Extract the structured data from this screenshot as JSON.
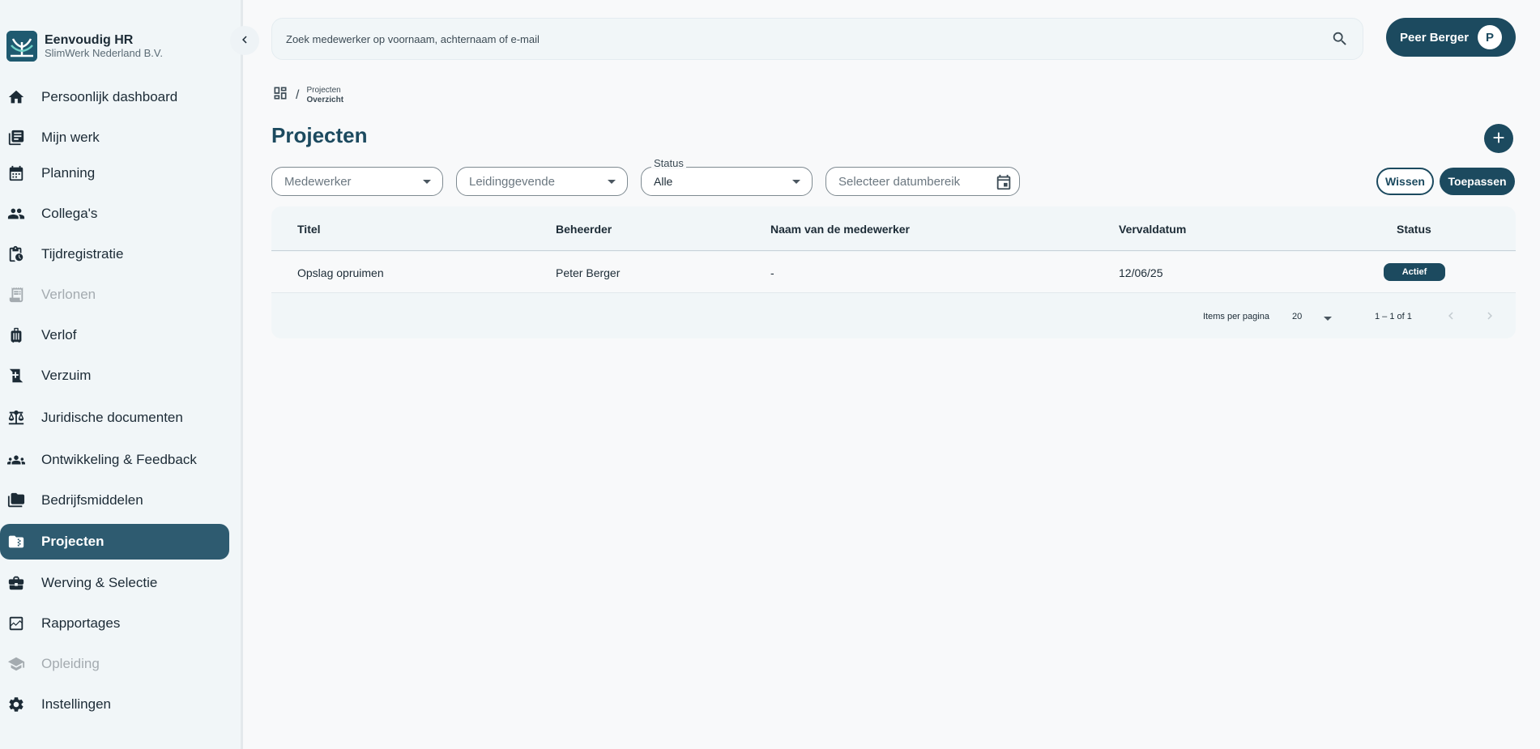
{
  "brand": {
    "name": "Eenvoudig HR",
    "org": "SlimWerk Nederland B.V.",
    "colors": {
      "primary": "#1c4a5f",
      "active_nav": "#2e5b70",
      "sidebar_bg": "#f1f6f8"
    }
  },
  "sidebar": {
    "collapse_icon": "chevron-left-icon",
    "items": [
      {
        "label": "Persoonlijk dashboard",
        "icon": "home-icon",
        "state": "normal"
      },
      {
        "label": "Mijn werk",
        "icon": "book-icon",
        "state": "normal"
      },
      {
        "label": "Planning",
        "icon": "calendar-icon",
        "state": "normal"
      },
      {
        "label": "Collega's",
        "icon": "people-icon",
        "state": "normal"
      },
      {
        "label": "Tijdregistratie",
        "icon": "clipboard-clock-icon",
        "state": "normal"
      },
      {
        "label": "Verlonen",
        "icon": "receipt-icon",
        "state": "disabled"
      },
      {
        "label": "Verlof",
        "icon": "luggage-icon",
        "state": "normal"
      },
      {
        "label": "Verzuim",
        "icon": "medical-icon",
        "state": "normal"
      },
      {
        "label": "Juridische documenten",
        "icon": "scale-icon",
        "state": "normal"
      },
      {
        "label": "Ontwikkeling & Feedback",
        "icon": "group-icon",
        "state": "normal"
      },
      {
        "label": "Bedrijfsmiddelen",
        "icon": "folders-icon",
        "state": "normal"
      },
      {
        "label": "Projecten",
        "icon": "folder-zip-icon",
        "state": "active"
      },
      {
        "label": "Werving & Selectie",
        "icon": "briefcase-icon",
        "state": "normal"
      },
      {
        "label": "Rapportages",
        "icon": "chart-icon",
        "state": "normal"
      },
      {
        "label": "Opleiding",
        "icon": "school-icon",
        "state": "disabled"
      },
      {
        "label": "Instellingen",
        "icon": "gear-icon",
        "state": "normal"
      }
    ]
  },
  "search": {
    "placeholder": "Zoek medewerker op voornaam, achternaam of e-mail",
    "icon": "search-icon"
  },
  "user": {
    "name": "Peer Berger",
    "initial": "P"
  },
  "breadcrumb": {
    "parent": "Projecten",
    "current": "Overzicht",
    "separator": "/",
    "icon": "dashboard-icon"
  },
  "page": {
    "title": "Projecten",
    "add_icon": "plus-icon"
  },
  "filters": {
    "employee": {
      "placeholder": "Medewerker"
    },
    "manager": {
      "placeholder": "Leidinggevende"
    },
    "status": {
      "label": "Status",
      "value": "Alle"
    },
    "date": {
      "placeholder": "Selecteer datumbereik",
      "icon": "calendar-icon"
    },
    "clear_label": "Wissen",
    "apply_label": "Toepassen"
  },
  "table": {
    "columns": [
      "Titel",
      "Beheerder",
      "Naam van de medewerker",
      "Vervaldatum",
      "Status"
    ],
    "rows": [
      {
        "title": "Opslag opruimen",
        "manager": "Peter Berger",
        "employee": "-",
        "due": "12/06/25",
        "status": "Actief"
      }
    ]
  },
  "pagination": {
    "items_per_page_label": "Items per pagina",
    "items_per_page": "20",
    "range": "1 – 1 of 1"
  }
}
